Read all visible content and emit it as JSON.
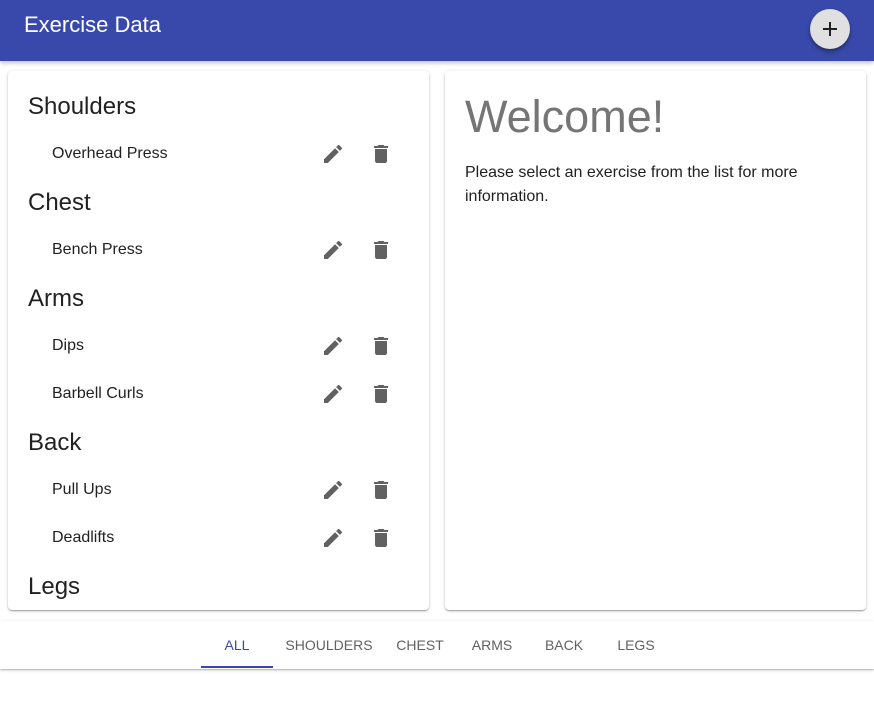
{
  "app": {
    "title": "Exercise Data",
    "accent": "#3949ab",
    "add_icon": "plus-icon"
  },
  "exercise_list": {
    "groups": [
      {
        "title": "Shoulders",
        "exercises": [
          "Overhead Press"
        ]
      },
      {
        "title": "Chest",
        "exercises": [
          "Bench Press"
        ]
      },
      {
        "title": "Arms",
        "exercises": [
          "Dips",
          "Barbell Curls"
        ]
      },
      {
        "title": "Back",
        "exercises": [
          "Pull Ups",
          "Deadlifts"
        ]
      },
      {
        "title": "Legs",
        "exercises": []
      }
    ],
    "edit_icon": "pencil-icon",
    "delete_icon": "trash-icon"
  },
  "detail": {
    "heading": "Welcome!",
    "body": "Please select an exercise from the list for more information."
  },
  "tabs": {
    "items": [
      "All",
      "Shoulders",
      "Chest",
      "Arms",
      "Back",
      "Legs"
    ],
    "active": "All"
  }
}
